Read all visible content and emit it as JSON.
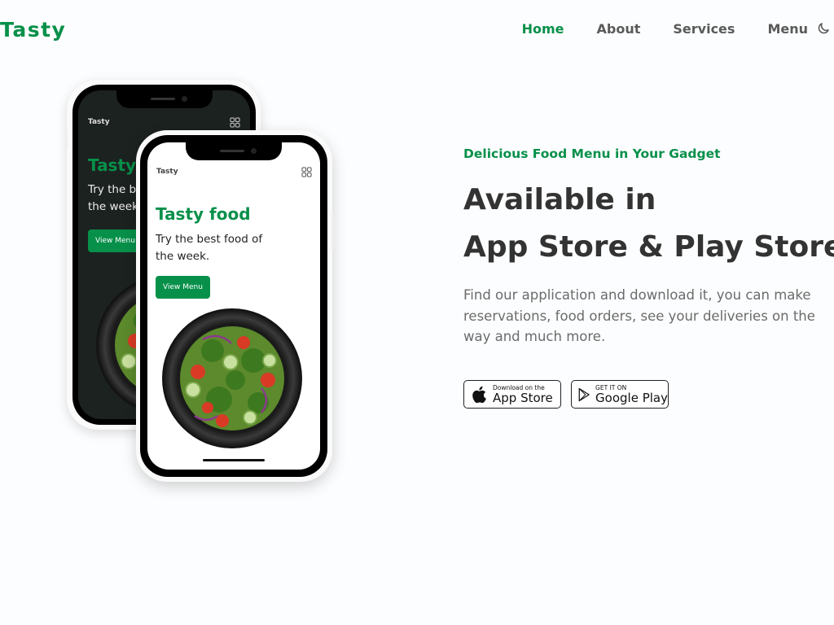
{
  "header": {
    "logo": "Tasty",
    "nav": [
      "Home",
      "About",
      "Services",
      "Menu"
    ],
    "active_nav": "Home",
    "theme_icon": "moon-icon"
  },
  "phones": {
    "back": {
      "app_name": "Tasty",
      "title": "Tasty food",
      "subtitle_line1": "Try the best food of",
      "subtitle_line2": "the week.",
      "button": "View Menu"
    },
    "front": {
      "app_name": "Tasty",
      "title": "Tasty food",
      "subtitle_line1": "Try the best food of",
      "subtitle_line2": "the week.",
      "button": "View Menu"
    }
  },
  "hero": {
    "subtitle": "Delicious Food Menu in Your Gadget",
    "headline_line1": "Available in",
    "headline_line2": "App Store & Play Store",
    "description": "Find our application and download it, you can make reservations, food orders, see your deliveries on the way and much more."
  },
  "stores": {
    "apple": {
      "small": "Download on the",
      "big": "App Store",
      "icon": "apple-icon"
    },
    "google": {
      "small": "GET IT ON",
      "big": "Google Play",
      "icon": "play-store-icon"
    }
  },
  "colors": {
    "accent": "#07904a",
    "text": "#333333",
    "muted": "#6b6b6b"
  }
}
